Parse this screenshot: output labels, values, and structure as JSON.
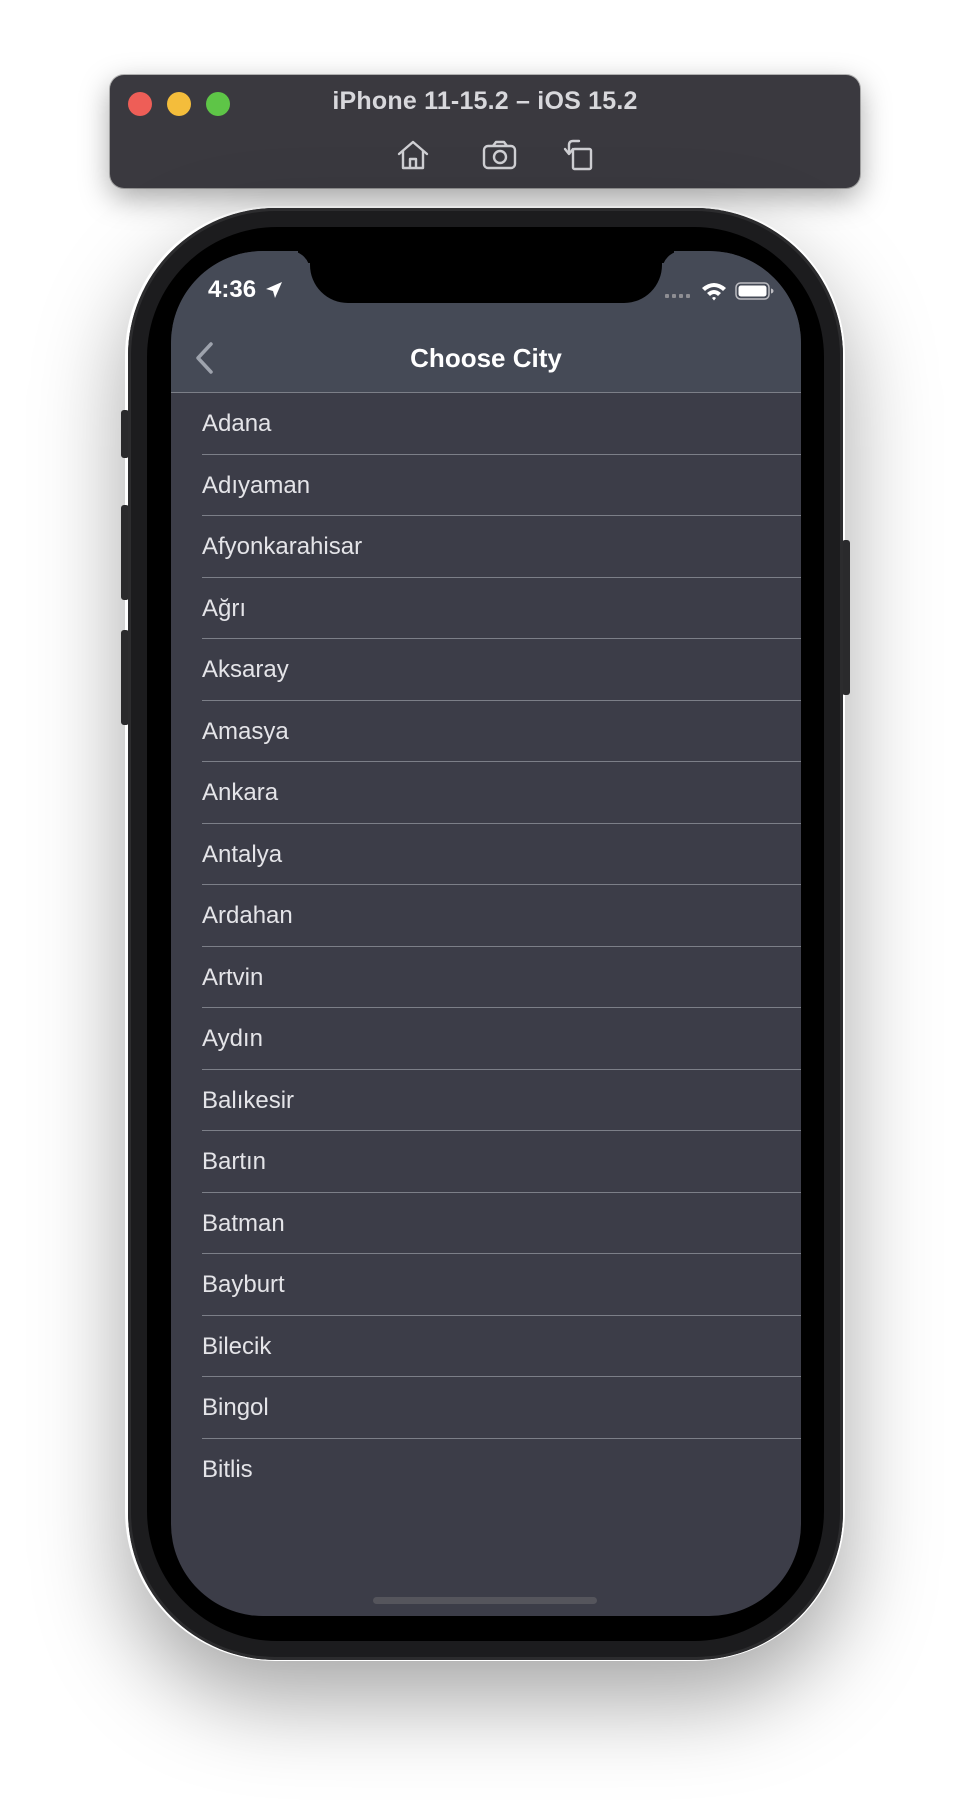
{
  "window": {
    "title": "iPhone 11-15.2 – iOS 15.2",
    "tools": [
      "home-icon",
      "screenshot-icon",
      "rotate-icon"
    ]
  },
  "status_bar": {
    "time": "4:36"
  },
  "nav": {
    "title": "Choose City"
  },
  "cities": [
    "Adana",
    "Adıyaman",
    "Afyonkarahisar",
    "Ağrı",
    "Aksaray",
    "Amasya",
    "Ankara",
    "Antalya",
    "Ardahan",
    "Artvin",
    "Aydın",
    "Balıkesir",
    "Bartın",
    "Batman",
    "Bayburt",
    "Bilecik",
    "Bingol",
    "Bitlis"
  ],
  "colors": {
    "screen_bg": "#3c3d48",
    "nav_bg": "#454a56",
    "separator": "#7c7f88",
    "toolbar_bg": "#3a393f"
  }
}
